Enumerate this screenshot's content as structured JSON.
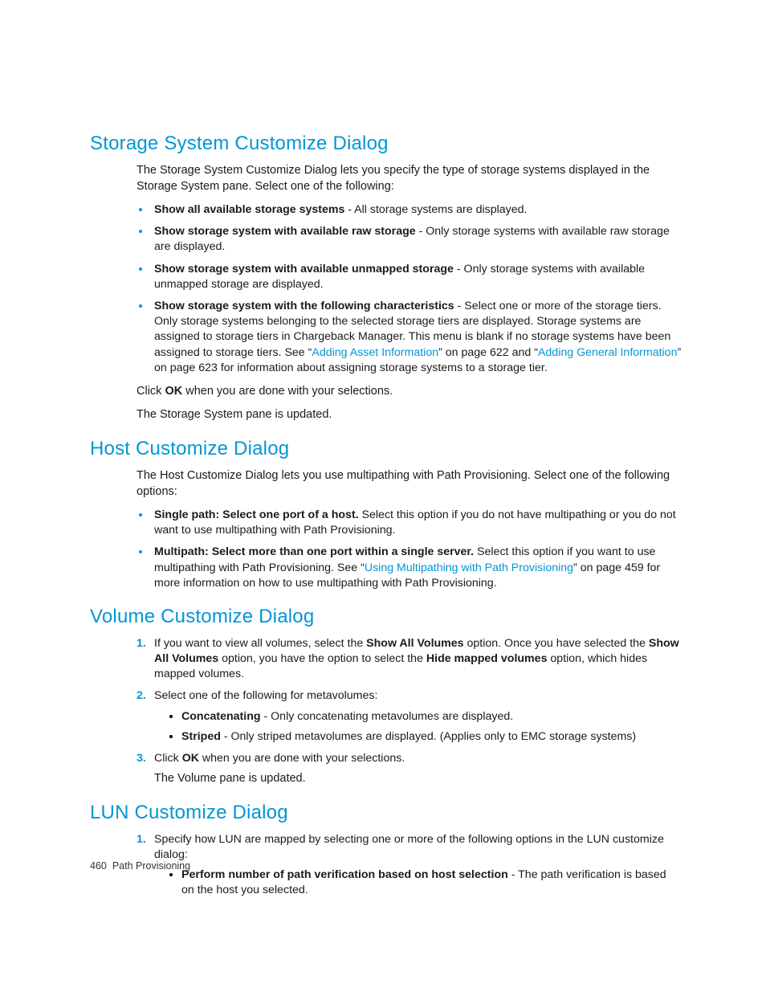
{
  "sections": {
    "storage": {
      "heading": "Storage System Customize Dialog",
      "intro": "The Storage System Customize Dialog lets you specify the type of storage systems displayed in the Storage System pane. Select one of the following:",
      "bullets": [
        {
          "bold": "Show all available storage systems",
          "rest": " - All storage systems are displayed."
        },
        {
          "bold": "Show storage system with available raw storage",
          "rest": " - Only storage systems with available raw storage are displayed."
        },
        {
          "bold": "Show storage system with available unmapped storage",
          "rest": " - Only storage systems with available unmapped storage are displayed."
        }
      ],
      "bullet4_bold": "Show storage system with the following characteristics",
      "bullet4_pre": " - Select one or more of the storage tiers. Only storage systems belonging to the selected storage tiers are displayed. Storage systems are assigned to storage tiers in Chargeback Manager. This menu is blank if no storage systems have been assigned to storage tiers. See “",
      "bullet4_link1": "Adding Asset Information",
      "bullet4_mid": "” on page 622 and “",
      "bullet4_link2": "Adding General Information",
      "bullet4_post": "” on page 623 for information about assigning storage systems to a storage tier.",
      "click_pre": "Click ",
      "click_bold": "OK",
      "click_post": " when you are done with your selections.",
      "result": "The Storage System pane is updated."
    },
    "host": {
      "heading": "Host Customize Dialog",
      "intro": "The Host Customize Dialog lets you use multipathing with Path Provisioning. Select one of the following options:",
      "b1_bold": "Single path: Select one port of a host.",
      "b1_rest": " Select this option if you do not have multipathing or you do not want to use multipathing with Path Provisioning.",
      "b2_bold": "Multipath: Select more than one port within a single server.",
      "b2_pre": " Select this option if you want to use multipathing with Path Provisioning. See “",
      "b2_link": "Using Multipathing with Path Provisioning",
      "b2_post": "” on page 459 for more information on how to use multipathing with Path Provisioning."
    },
    "volume": {
      "heading": "Volume Customize Dialog",
      "n1_pre": "If you want to view all volumes, select the ",
      "n1_b1": "Show All Volumes",
      "n1_mid": " option. Once you have selected the ",
      "n1_b2": "Show All Volumes",
      "n1_mid2": " option, you have the option to select the ",
      "n1_b3": "Hide mapped volumes",
      "n1_post": " option, which hides mapped volumes.",
      "n2": "Select one of the following for metavolumes:",
      "n2_sub": [
        {
          "bold": "Concatenating",
          "rest": " - Only concatenating metavolumes are displayed."
        },
        {
          "bold": "Striped",
          "rest": " - Only striped metavolumes are displayed. (Applies only to EMC storage systems)"
        }
      ],
      "n3_pre": "Click ",
      "n3_bold": "OK",
      "n3_post": " when you are done with your selections.",
      "n3_result": "The Volume pane is updated."
    },
    "lun": {
      "heading": "LUN Customize Dialog",
      "n1": "Specify how LUN are mapped by selecting one or more of the following options in the LUN customize dialog:",
      "n1_sub_bold": "Perform number of path verification based on host selection",
      "n1_sub_rest": " - The path verification is based on the host you selected."
    }
  },
  "footer": {
    "page": "460",
    "chapter": "Path Provisioning"
  }
}
